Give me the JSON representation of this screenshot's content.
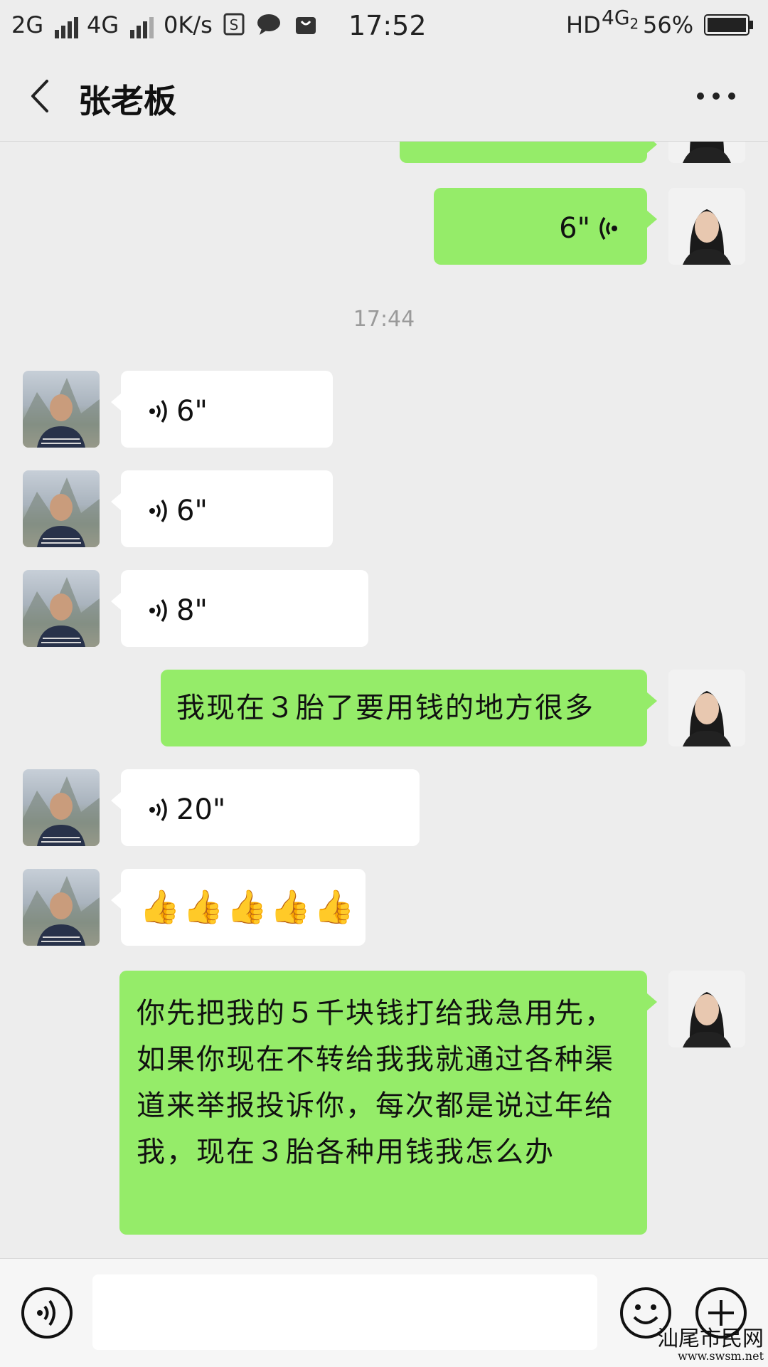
{
  "status_bar": {
    "network_left": "2G",
    "network_mid": "4G",
    "speed": "0K/s",
    "time": "17:52",
    "hd": "HD",
    "network_right": "4G",
    "network_right_sub": "2",
    "battery": "56%"
  },
  "header": {
    "title": "张老板"
  },
  "messages": {
    "m1": {
      "duration": "6\""
    },
    "timestamp": "17:44",
    "m2": {
      "duration": "6\""
    },
    "m3": {
      "duration": "6\""
    },
    "m4": {
      "duration": "8\""
    },
    "m5": {
      "text": "我现在３胎了要用钱的地方很多"
    },
    "m6": {
      "duration": "20\""
    },
    "m7": {
      "emojis": "👍👍👍👍👍"
    },
    "m8": {
      "text": "你先把我的５千块钱打给我急用先，如果你现在不转给我我就通过各种渠道来举报投诉你，每次都是说过年给我，现在３胎各种用钱我怎么办"
    }
  },
  "watermark": {
    "name": "汕尾市民网",
    "url": "www.swsm.net"
  },
  "colors": {
    "background": "#ededed",
    "sent_bubble": "#95ec69",
    "received_bubble": "#ffffff"
  }
}
